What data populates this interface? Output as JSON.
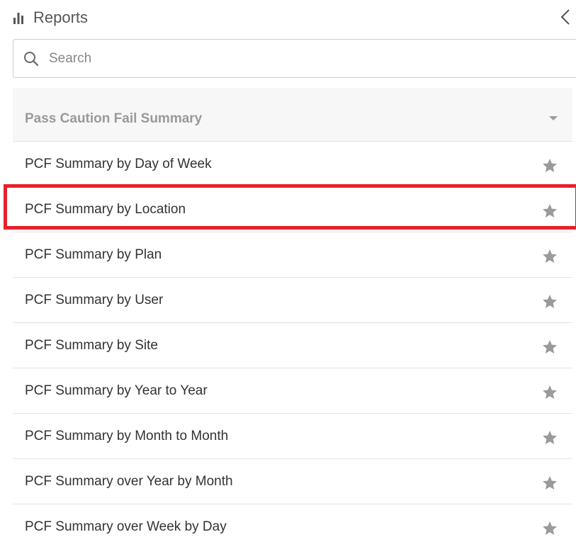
{
  "header": {
    "title": "Reports",
    "icon": "bar-chart-icon",
    "collapse_icon": "chevron-left-icon"
  },
  "search": {
    "placeholder": "Search",
    "value": "",
    "icon": "search-icon"
  },
  "section": {
    "title": "Pass Caution Fail Summary",
    "icon": "caret-down-icon"
  },
  "reports": [
    {
      "label": "PCF Summary by Day of Week",
      "favorite": false
    },
    {
      "label": "PCF Summary by Location",
      "favorite": false
    },
    {
      "label": "PCF Summary by Plan",
      "favorite": false
    },
    {
      "label": "PCF Summary by User",
      "favorite": false
    },
    {
      "label": "PCF Summary by Site",
      "favorite": false
    },
    {
      "label": "PCF Summary by Year to Year",
      "favorite": false
    },
    {
      "label": "PCF Summary by Month to Month",
      "favorite": false
    },
    {
      "label": "PCF Summary over Year by Month",
      "favorite": false
    },
    {
      "label": "PCF Summary over Week by Day",
      "favorite": false
    }
  ],
  "highlighted_item": "PCF Summary by Location",
  "colors": {
    "highlight": "#e6202c",
    "section_background": "#f7f7f7",
    "star": "#9a9a9a"
  }
}
